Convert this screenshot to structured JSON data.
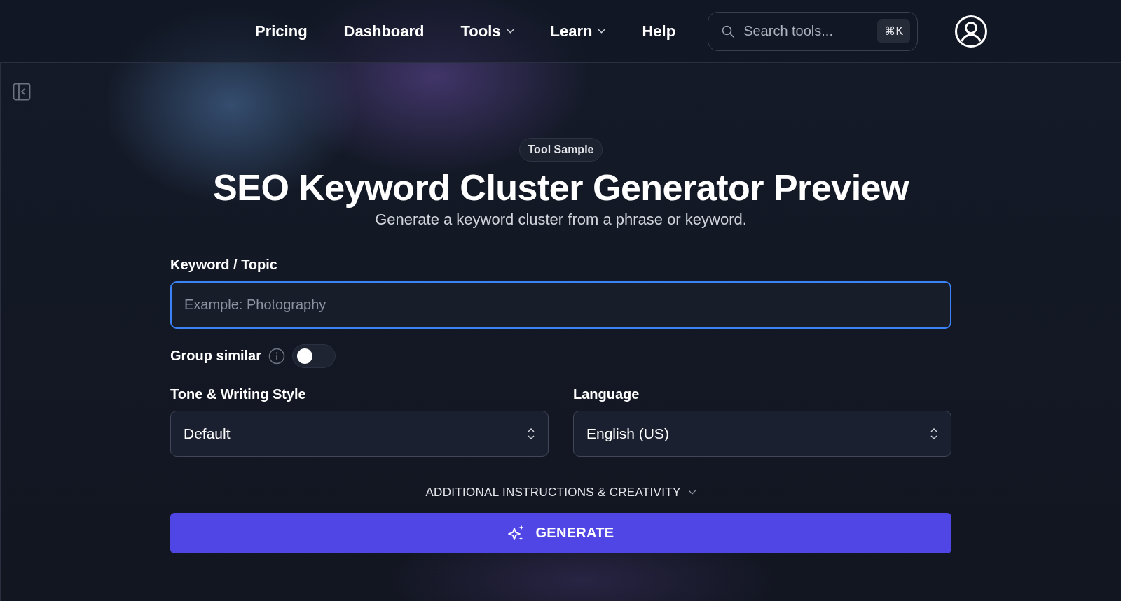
{
  "nav": {
    "items": [
      {
        "label": "Pricing",
        "has_dropdown": false
      },
      {
        "label": "Dashboard",
        "has_dropdown": false
      },
      {
        "label": "Tools",
        "has_dropdown": true
      },
      {
        "label": "Learn",
        "has_dropdown": true
      },
      {
        "label": "Help",
        "has_dropdown": false
      }
    ],
    "search": {
      "placeholder": "Search tools...",
      "shortcut": "⌘K"
    }
  },
  "badge": "Tool Sample",
  "title": "SEO Keyword Cluster Generator Preview",
  "subtitle": "Generate a keyword cluster from a phrase or keyword.",
  "keyword": {
    "label": "Keyword / Topic",
    "placeholder": "Example: Photography"
  },
  "group_similar": {
    "label": "Group similar",
    "on": false
  },
  "selects": [
    {
      "label": "Tone & Writing Style",
      "value": "Default"
    },
    {
      "label": "Language",
      "value": "English (US)"
    }
  ],
  "additional": {
    "label": "ADDITIONAL INSTRUCTIONS & CREATIVITY",
    "expanded": false
  },
  "generate": "GENERATE"
}
